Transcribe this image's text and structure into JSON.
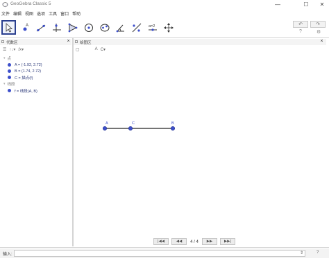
{
  "window": {
    "title": "GeoGebra Classic 5",
    "minimize_glyph": "—",
    "maximize_glyph": "☐",
    "close_glyph": "✕"
  },
  "menu": [
    "文件",
    "编辑",
    "视图",
    "选项",
    "工具",
    "窗口",
    "帮助"
  ],
  "toolbar": {
    "tools": [
      {
        "name": "move-tool",
        "icon": "arrow-cursor-icon",
        "selected": true
      },
      {
        "name": "point-tool",
        "icon": "point-icon"
      },
      {
        "name": "line-tool",
        "icon": "line-icon"
      },
      {
        "name": "perpendicular-tool",
        "icon": "perpendicular-icon"
      },
      {
        "name": "polygon-tool",
        "icon": "polygon-icon"
      },
      {
        "name": "circle-tool",
        "icon": "circle-icon"
      },
      {
        "name": "conic-tool",
        "icon": "ellipse-icon"
      },
      {
        "name": "angle-tool",
        "icon": "angle-icon"
      },
      {
        "name": "reflect-tool",
        "icon": "reflect-icon"
      },
      {
        "name": "slider-tool",
        "icon": "slider-icon",
        "label": "a=2"
      },
      {
        "name": "move-view-tool",
        "icon": "move-view-icon"
      }
    ],
    "undo_glyph": "↶",
    "redo_glyph": "↷",
    "help_glyph": "?",
    "settings_glyph": "⚙"
  },
  "algebra_view": {
    "title": "代数区",
    "toolbar_items": [
      "☰",
      "↑↓▾",
      "fx▾"
    ],
    "categories": [
      {
        "label": "点",
        "items": [
          "A = (-1.92, 2.72)",
          "B = (1.74, 2.72)",
          "C = 描点(f)"
        ]
      },
      {
        "label": "线段",
        "items": [
          "f = 线段(A, B)"
        ]
      }
    ]
  },
  "graphics_view": {
    "title": "绘图区",
    "style_items": [
      "▢",
      "A",
      "C▾"
    ],
    "points": [
      {
        "label": "A"
      },
      {
        "label": "C"
      },
      {
        "label": "B"
      }
    ],
    "point_color": "#3d4fcb",
    "segment_color": "#222222"
  },
  "navigation": {
    "buttons": [
      "|◀◀",
      "◀◀",
      "▶▶",
      "▶▶|"
    ],
    "counter": "4 / 4"
  },
  "input_bar": {
    "label": "输入:",
    "value": "",
    "dropdown_glyph": "⇕",
    "help_glyph": "?"
  }
}
